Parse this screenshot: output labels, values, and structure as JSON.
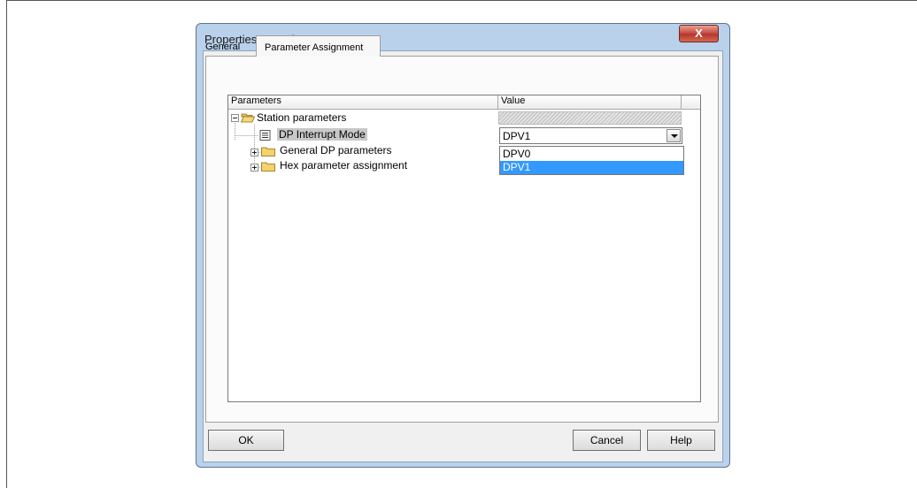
{
  "dialog": {
    "title": "Properties - DP slave",
    "close_label": "X"
  },
  "tabs": [
    {
      "label": "General",
      "active": false
    },
    {
      "label": "Parameter Assignment",
      "active": true
    }
  ],
  "grid": {
    "columns": [
      "Parameters",
      "Value"
    ],
    "rows": [
      {
        "label": "Station parameters",
        "icon": "open-folder-icon",
        "expander": "minus"
      },
      {
        "label": "DP Interrupt Mode",
        "icon": "list-item-icon",
        "selected": true
      },
      {
        "label": "General DP parameters",
        "icon": "folder-icon",
        "expander": "plus"
      },
      {
        "label": "Hex parameter assignment",
        "icon": "folder-icon",
        "expander": "plus"
      }
    ]
  },
  "combo": {
    "value": "DPV1",
    "options": [
      "DPV0",
      "DPV1"
    ],
    "highlighted_index": 1
  },
  "buttons": {
    "ok": "OK",
    "cancel": "Cancel",
    "help": "Help"
  },
  "colors": {
    "selection": "#3399ff",
    "dialog_frame": "#b9d1ea",
    "close_button": "#c75048"
  }
}
